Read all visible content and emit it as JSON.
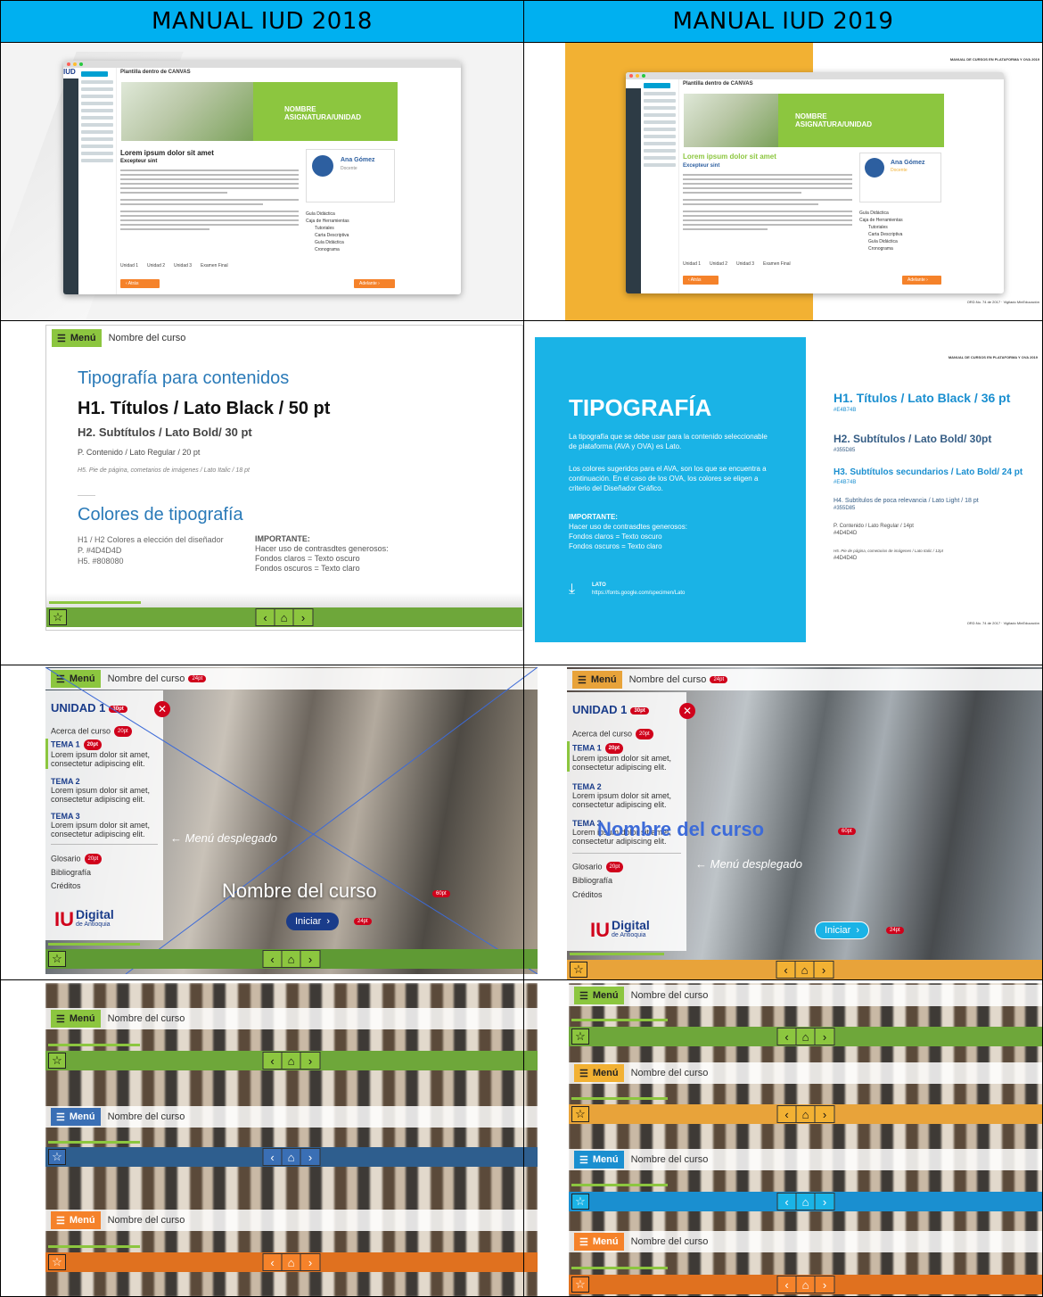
{
  "headers": {
    "left": "MANUAL IUD 2018",
    "right": "MANUAL IUD 2019"
  },
  "row1": {
    "window_title": "Plantilla dentro de CANVAS",
    "banner_title": "NOMBRE ASIGNATURA/UNIDAD",
    "lorem_title": "Lorem ipsum dolor sit amet",
    "excepteur": "Excepteur sint",
    "teacher_name": "Ana Gómez",
    "teacher_role": "Docente",
    "tools": [
      "Guía Didáctica",
      "Caja de Herramientas",
      "Tutoriales",
      "Carta Descriptiva",
      "Guía Didáctica",
      "Cronograma"
    ],
    "tabs": [
      "Unidad 1",
      "Unidad 2",
      "Unidad 3",
      "Examen Final"
    ],
    "prev": "Atrás",
    "next": "Adelante",
    "logo": "IUD",
    "manual_header": "MANUAL DE CURSOS EN PLATAFORMA Y OVA 2019",
    "ords": "ORD.No. 74 de 2017 · Vigilado MinEducación"
  },
  "row2_left": {
    "menu": "Menú",
    "course": "Nombre del curso",
    "section_title": "Tipografía para contenidos",
    "h1": "H1. Títulos / Lato Black / 50 pt",
    "h2": "H2. Subtítulos / Lato Bold/ 30 pt",
    "p": "P. Contenido / Lato Regular / 20 pt",
    "h5": "H5. Pie de página, cometarios de imágenes / Lato Italic / 18 pt",
    "colors_title": "Colores de tipografía",
    "color_lines": [
      "H1 / H2  Colores a elección del diseñador",
      "P. #4D4D4D",
      "H5. #808080"
    ],
    "important": "IMPORTANTE:",
    "important_lines": [
      "Hacer uso de contrasdtes generosos:",
      "Fondos claros = Texto oscuro",
      "Fondos oscuros = Texto claro"
    ]
  },
  "row2_right": {
    "manual_header": "MANUAL DE CURSOS EN PLATAFORMA Y OVA 2019",
    "title": "TIPOGRAFÍA",
    "intro": "La tipografía que se debe usar para la contenido seleccionable de plataforma (AVA y OVA) es Lato.",
    "colors_text": "Los colores sugeridos para el AVA, son los que se encuentra a continuación. En el caso de los OVA, los colores se eligen a criterio del Diseñador Gráfico.",
    "important": "IMPORTANTE:",
    "important_lines": [
      "Hacer uso de contrasdtes generosos:",
      "Fondos claros = Texto oscuro",
      "Fondos oscuros = Texto claro"
    ],
    "lato": "LATO",
    "lato_url": "https://fonts.google.com/specimen/Lato",
    "h1": "H1. Títulos / Lato Black / 36 pt",
    "h1c": "#E4B74B",
    "h2": "H2. Subtítulos / Lato Bold/ 30pt",
    "h2c": "#355D85",
    "h3": "H3. Subtítulos secundarios / Lato Bold/ 24 pt",
    "h3c": "#E4B74B",
    "h4": "H4. Subtítulos de poca relevancia / Lato Light / 18 pt",
    "h4c": "#355D85",
    "p": "P. Contenido / Lato Regular / 14pt",
    "pc": "#4D4D4D",
    "h5": "H5. Pie de página, cometarios de imágenes / Lato Italic / 12pt",
    "h5c": "#4D4D4D",
    "ords": "ORD.No. 74 de 2017 · Vigilado MinEducación"
  },
  "row3": {
    "menu": "Menú",
    "course": "Nombre del curso",
    "unit": "UNIDAD 1",
    "about": "Acerca del curso",
    "tema1": "TEMA 1",
    "tema2": "TEMA 2",
    "tema3": "TEMA 3",
    "lorem": "Lorem ipsum dolor sit amet, consectetur adipiscing elit.",
    "glosario": "Glosario",
    "bibliografia": "Bibliografía",
    "creditos": "Créditos",
    "menu_note": "← Menú desplegado",
    "big_name": "Nombre del curso",
    "start": "Iniciar",
    "tags": {
      "t24": "24pt",
      "t30": "30pt",
      "t20": "20pt",
      "t60": "60pt"
    },
    "logo_main": "Digital",
    "logo_sub": "de Antioquia",
    "logo_mark": "IU"
  },
  "row4": {
    "menu": "Menú",
    "course": "Nombre del curso"
  },
  "colors": {
    "header": "#00b0f0",
    "green": "#8cc63f",
    "blue": "#3a6fb5",
    "orange": "#f5822a",
    "amber": "#e8a33a",
    "cyan": "#1ab3e6"
  }
}
